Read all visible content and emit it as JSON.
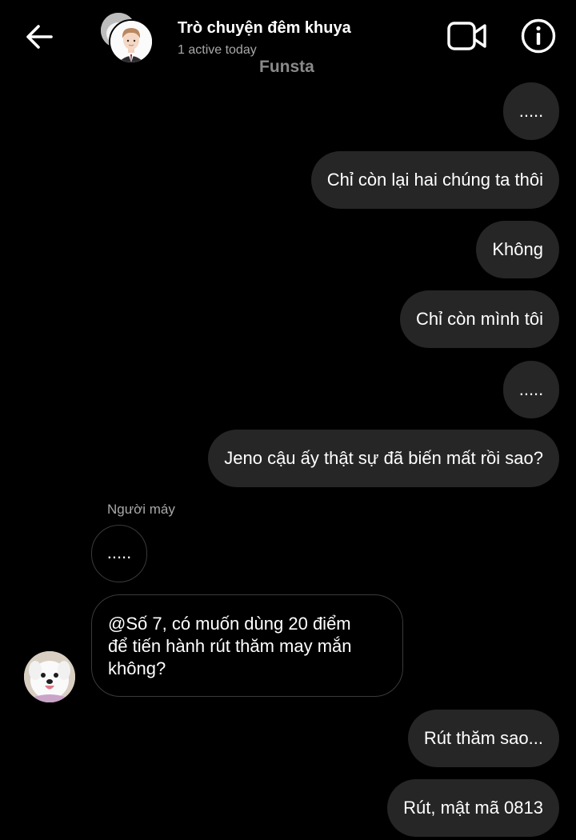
{
  "header": {
    "title": "Trò chuyện đêm khuya",
    "status": "1 active today",
    "watermark": "Funsta"
  },
  "sender_label": "Người máy",
  "messages": [
    {
      "side": "sent",
      "text": "....."
    },
    {
      "side": "sent",
      "text": "Chỉ còn lại hai chúng ta thôi"
    },
    {
      "side": "sent",
      "text": "Không"
    },
    {
      "side": "sent",
      "text": "Chỉ còn mình tôi"
    },
    {
      "side": "sent",
      "text": "....."
    },
    {
      "side": "sent",
      "text": "Jeno cậu ấy thật sự đã biến mất rồi sao?"
    },
    {
      "side": "received",
      "text": "....."
    },
    {
      "side": "received",
      "lines": [
        "@Số 7, có muốn dùng 20 điểm",
        "để tiến hành rút thăm may mắn",
        "không?"
      ]
    },
    {
      "side": "sent",
      "text": "Rút thăm sao..."
    },
    {
      "side": "sent",
      "text": "Rút, mật mã 0813"
    }
  ],
  "colors": {
    "background": "#000000",
    "sent_bubble": "#262626",
    "received_border": "#3a3a3a",
    "secondary_text": "#a8a8a8"
  },
  "icons": {
    "back": "arrow-left-icon",
    "video": "video-camera-icon",
    "info": "info-icon"
  }
}
